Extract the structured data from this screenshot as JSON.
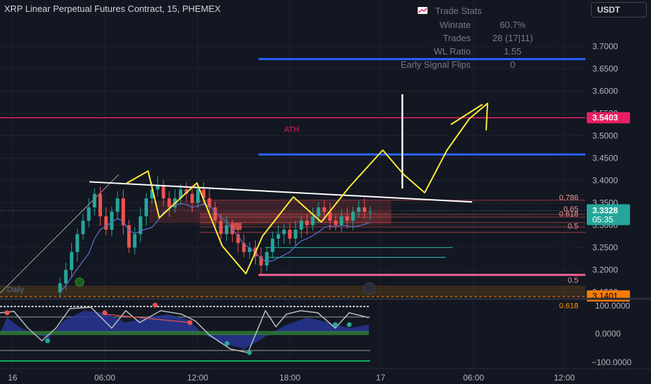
{
  "title": "XRP Linear Perpetual Futures Contract, 15, PHEMEX",
  "currency_button": "USDT",
  "trade_stats": {
    "title": "Trade Stats",
    "rows": [
      {
        "label": "Winrate",
        "value": "60.7%"
      },
      {
        "label": "Trades",
        "value": "28 (17|11)"
      },
      {
        "label": "WL Ratio",
        "value": "1.55"
      },
      {
        "label": "Early Signal Flips",
        "value": "0"
      }
    ]
  },
  "price_axis": {
    "ticks": [
      "3.7000",
      "3.6500",
      "3.6000",
      "3.5500",
      "3.5000",
      "3.4500",
      "3.4000",
      "3.3500",
      "3.3000",
      "3.2500",
      "3.2000",
      "3.1500"
    ],
    "tick_values": [
      3.7,
      3.65,
      3.6,
      3.55,
      3.5,
      3.45,
      3.4,
      3.35,
      3.3,
      3.25,
      3.2,
      3.15
    ]
  },
  "price_labels": {
    "ath": {
      "text": "3.5403",
      "value": 3.5403,
      "color": "#e91e63"
    },
    "last": {
      "text": "3.3328",
      "countdown": "05:35",
      "value": 3.3328,
      "color": "#26a69a"
    },
    "support": {
      "text": "3.1401",
      "value": 3.1401,
      "color": "#f57c00"
    }
  },
  "annotations": {
    "ath_text": "ATH",
    "fib_786": "0.786",
    "fib_65": "0.65",
    "fib_618": "0.618",
    "fib_5": "0.5",
    "fib_5_lower": "0.5",
    "fib_618_lower": "0.618",
    "daily": "Daily"
  },
  "oscillator_axis": {
    "ticks": [
      "100.0000",
      "0.0000",
      "−100.0000"
    ],
    "tick_values": [
      100,
      0,
      -100
    ]
  },
  "time_axis": {
    "labels": [
      "16",
      "06:00",
      "12:00",
      "18:00",
      "17",
      "06:00",
      "12:00"
    ]
  },
  "colors": {
    "background": "#131722",
    "up": "#26a69a",
    "down": "#ef5350",
    "blue_line": "#2962ff",
    "pink_line": "#e91e63",
    "yellow_drawing": "#ffeb3b"
  },
  "chart_data": {
    "type": "candlestick",
    "title": "XRP Linear Perpetual Futures Contract, 15, PHEMEX",
    "ylim": [
      3.14,
      3.76
    ],
    "horizontal_levels": [
      3.6716,
      3.5403,
      3.4582,
      3.1888,
      3.1401
    ],
    "trendline": [
      [
        0.0,
        3.397
      ],
      [
        1.0,
        3.352
      ]
    ],
    "ohlc_path": [
      3.17,
      3.2,
      3.24,
      3.28,
      3.31,
      3.34,
      3.37,
      3.32,
      3.29,
      3.33,
      3.36,
      3.3,
      3.25,
      3.28,
      3.32,
      3.36,
      3.38,
      3.39,
      3.36,
      3.34,
      3.36,
      3.38,
      3.37,
      3.35,
      3.38,
      3.36,
      3.34,
      3.31,
      3.28,
      3.3,
      3.28,
      3.26,
      3.24,
      3.25,
      3.23,
      3.21,
      3.24,
      3.27,
      3.28,
      3.29,
      3.27,
      3.29,
      3.31,
      3.3,
      3.32,
      3.34,
      3.33,
      3.31,
      3.3,
      3.32,
      3.31,
      3.33,
      3.34,
      3.33,
      3.33
    ],
    "oscillator": {
      "ylim": [
        -100,
        100
      ]
    }
  }
}
